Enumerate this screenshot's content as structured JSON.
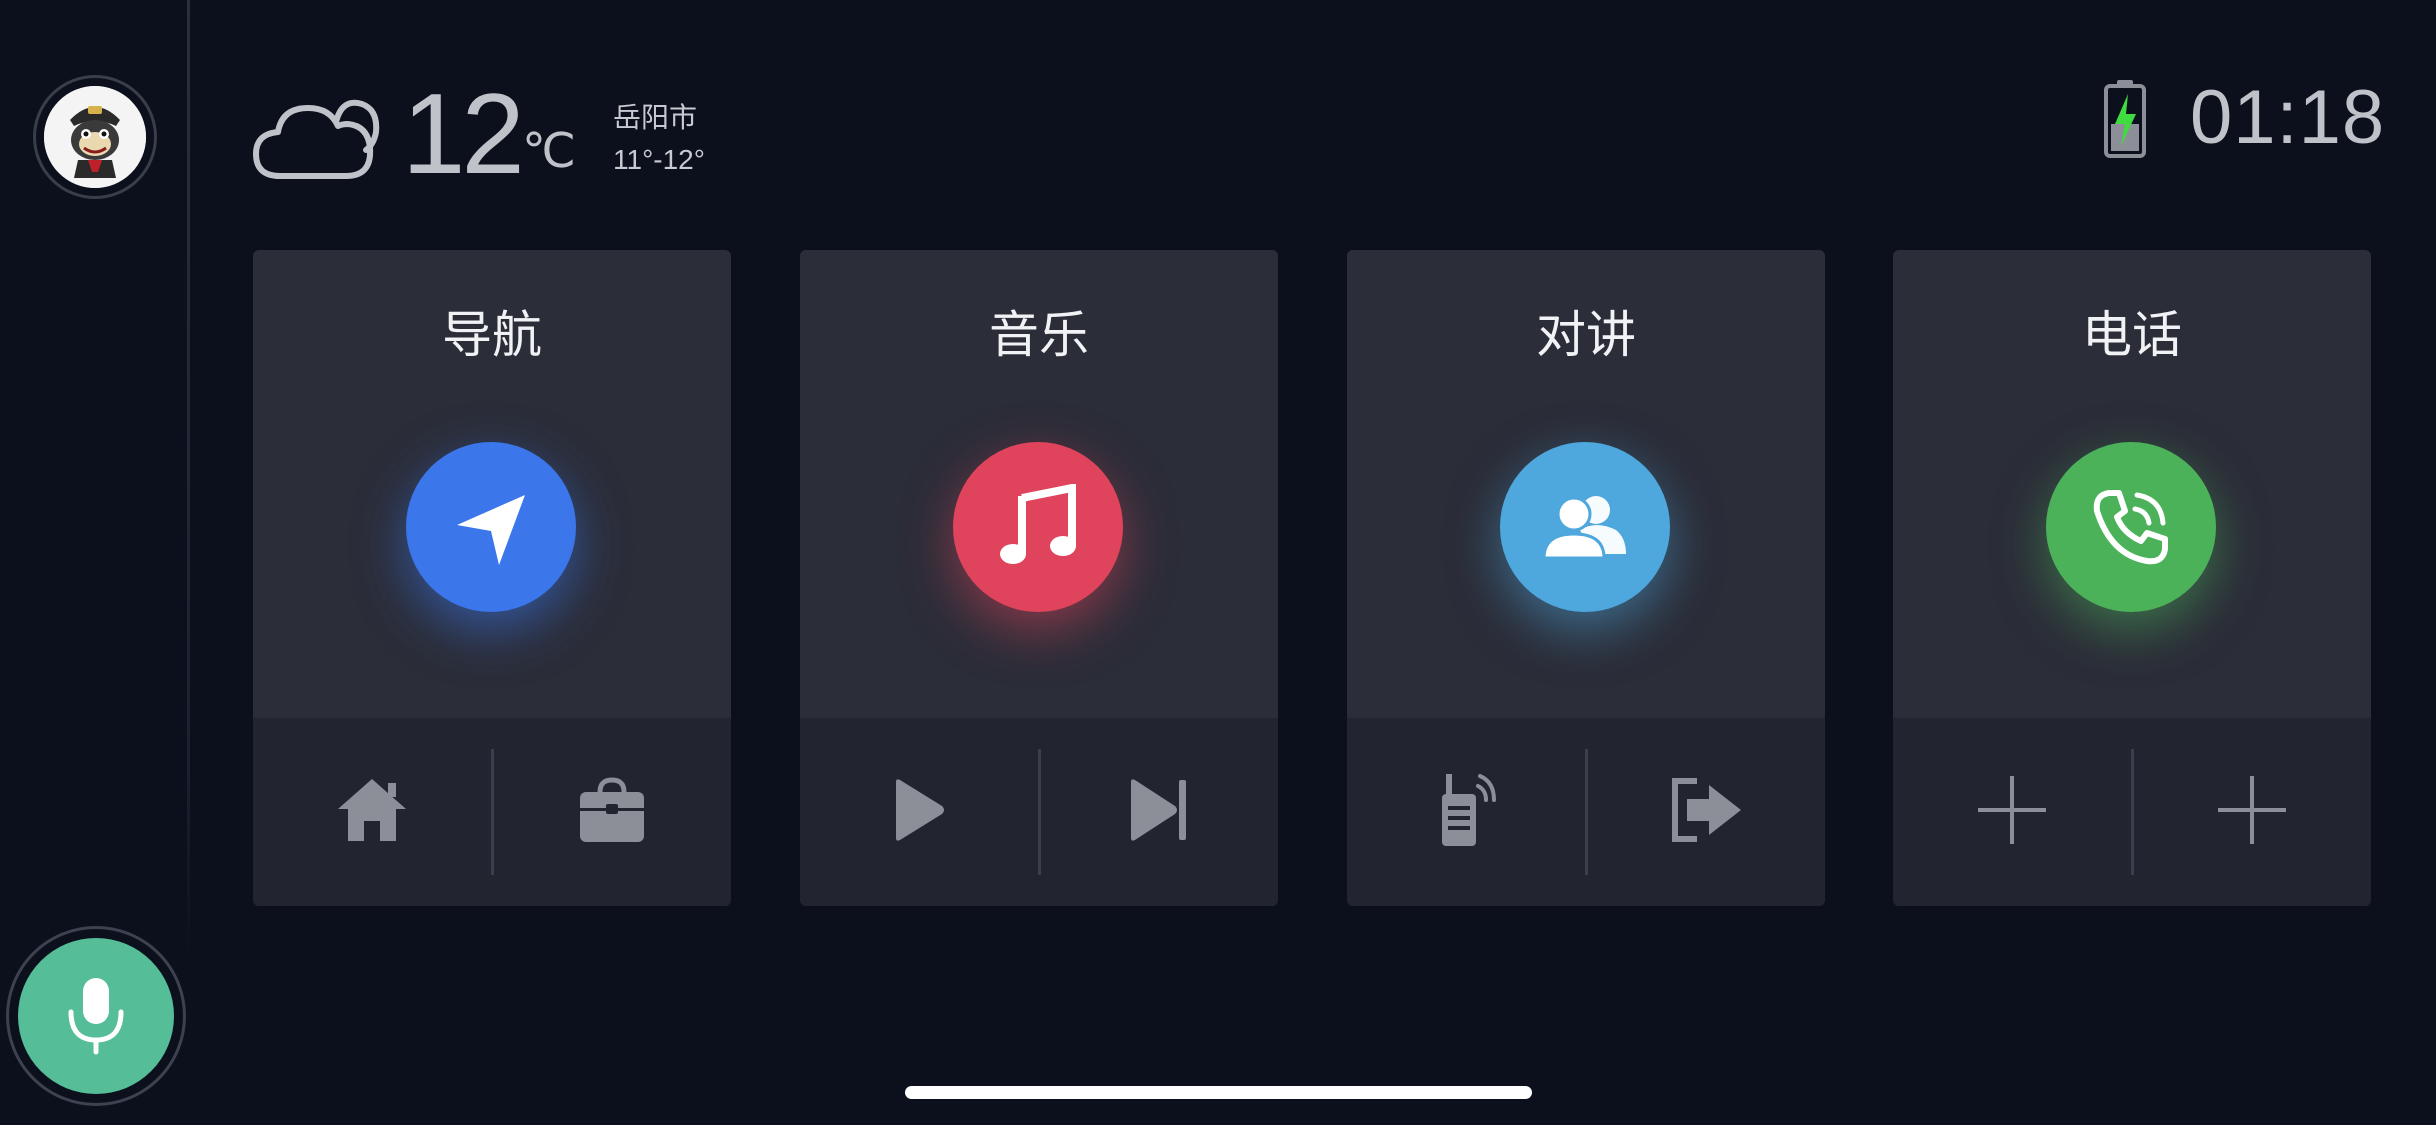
{
  "header": {
    "weather_icon": "cloud-icon",
    "temperature": "12",
    "temperature_unit": "℃",
    "city": "岳阳市",
    "range": "11°-12°",
    "battery_icon": "battery-charging-icon",
    "time": "01:18"
  },
  "sidebar": {
    "avatar_icon": "avatar-mascot",
    "voice_icon": "microphone-icon",
    "voice_color": "#55be98"
  },
  "cards": [
    {
      "title": "导航",
      "icon": "navigation-arrow-icon",
      "color": "#3b76ea",
      "actions": [
        "home-icon",
        "briefcase-icon"
      ]
    },
    {
      "title": "音乐",
      "icon": "music-note-icon",
      "color": "#e0435c",
      "actions": [
        "play-icon",
        "skip-next-icon"
      ]
    },
    {
      "title": "对讲",
      "icon": "group-icon",
      "color": "#4ea7dd",
      "actions": [
        "walkie-talkie-icon",
        "exit-icon"
      ]
    },
    {
      "title": "电话",
      "icon": "phone-icon",
      "color": "#4bb25a",
      "actions": [
        "add-icon",
        "add-icon"
      ]
    }
  ]
}
